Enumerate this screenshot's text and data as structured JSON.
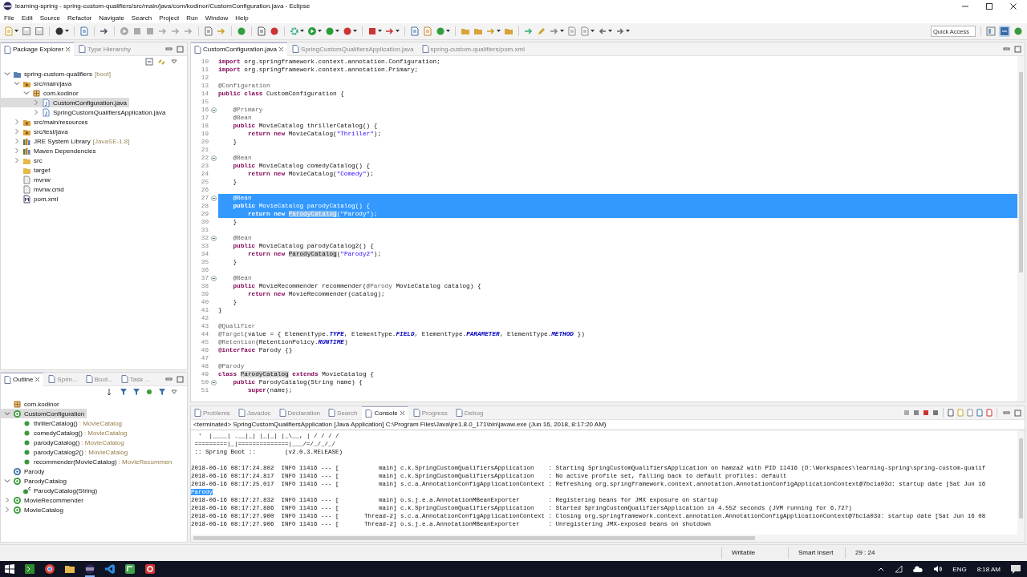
{
  "window": {
    "title": "learning-spring - spring-custom-qualifiers/src/main/java/com/kodinor/CustomConfiguration.java - Eclipse"
  },
  "menu": [
    "File",
    "Edit",
    "Source",
    "Refactor",
    "Navigate",
    "Search",
    "Project",
    "Run",
    "Window",
    "Help"
  ],
  "quick_access": {
    "placeholder": "Quick Access"
  },
  "package_explorer": {
    "tabs": [
      {
        "label": "Package Explorer",
        "selected": true
      },
      {
        "label": "Type Hierarchy",
        "selected": false
      }
    ],
    "tree": [
      {
        "label": "spring-custom-qualifiers",
        "suffix": "[boot]",
        "kind": "project",
        "expanded": true,
        "selected": false,
        "children": [
          {
            "label": "src/main/java",
            "kind": "source-folder",
            "expanded": true,
            "selected": false,
            "children": [
              {
                "label": "com.kodinor",
                "kind": "package",
                "expanded": true,
                "selected": false,
                "children": [
                  {
                    "label": "CustomConfiguration.java",
                    "kind": "java-file",
                    "expanded": false,
                    "selected": true
                  },
                  {
                    "label": "SpringCustomQualifiersApplication.java",
                    "kind": "java-file",
                    "expanded": false,
                    "selected": false
                  }
                ]
              }
            ]
          },
          {
            "label": "src/main/resources",
            "kind": "source-folder",
            "expanded": false,
            "selected": false
          },
          {
            "label": "src/test/java",
            "kind": "source-folder",
            "expanded": false,
            "selected": false
          },
          {
            "label": "JRE System Library",
            "suffix": "[JavaSE-1.8]",
            "kind": "library",
            "expanded": false,
            "selected": false
          },
          {
            "label": "Maven Dependencies",
            "kind": "library",
            "expanded": false,
            "selected": false
          },
          {
            "label": "src",
            "kind": "folder",
            "expanded": false,
            "selected": false
          },
          {
            "label": "target",
            "kind": "folder",
            "selected": false
          },
          {
            "label": "mvnw",
            "kind": "file",
            "selected": false
          },
          {
            "label": "mvnw.cmd",
            "kind": "file",
            "selected": false
          },
          {
            "label": "pom.xml",
            "kind": "xml",
            "selected": false
          }
        ]
      }
    ]
  },
  "outline": {
    "tabs": [
      {
        "label": "Outline",
        "selected": true
      },
      {
        "label": "Sprin...",
        "selected": false
      },
      {
        "label": "Boot...",
        "selected": false
      },
      {
        "label": "Task ...",
        "selected": false
      }
    ],
    "tree": [
      {
        "label": "com.kodinor",
        "kind": "package",
        "selected": false
      },
      {
        "label": "CustomConfiguration",
        "kind": "class",
        "expanded": true,
        "selected": true,
        "children": [
          {
            "label": "thrillerCatalog()",
            "type": ": MovieCatalog",
            "kind": "method",
            "selected": false
          },
          {
            "label": "comedyCatalog()",
            "type": ": MovieCatalog",
            "kind": "method",
            "selected": false
          },
          {
            "label": "parodyCatalog()",
            "type": ": MovieCatalog",
            "kind": "method",
            "selected": false
          },
          {
            "label": "parodyCatalog2()",
            "type": ": MovieCatalog",
            "kind": "method",
            "selected": false
          },
          {
            "label": "recommender(MovieCatalog)",
            "type": ": MovieRecommen",
            "kind": "method",
            "selected": false
          }
        ]
      },
      {
        "label": "Parody",
        "kind": "annotation",
        "selected": false
      },
      {
        "label": "ParodyCatalog",
        "kind": "class",
        "expanded": true,
        "selected": false,
        "children": [
          {
            "label": "ParodyCatalog(String)",
            "kind": "constructor",
            "selected": false
          }
        ]
      },
      {
        "label": "MovieRecommender",
        "kind": "class",
        "expanded": false,
        "selected": false
      },
      {
        "label": "MovieCatalog",
        "kind": "class",
        "expanded": false,
        "selected": false
      }
    ]
  },
  "editor": {
    "tabs": [
      {
        "label": "CustomConfiguration.java",
        "selected": true
      },
      {
        "label": "SpringCustomQualifiersApplication.java",
        "selected": false
      },
      {
        "label": "spring-custom-qualifiers/pom.xml",
        "selected": false
      }
    ],
    "lines": [
      {
        "num": "10",
        "fold": false,
        "selected": false,
        "segments": [
          {
            "kind": "keyword",
            "text": "import"
          },
          {
            "kind": "plain",
            "text": " org.springframework.context.annotation.Configuration;"
          }
        ]
      },
      {
        "num": "11",
        "fold": false,
        "selected": false,
        "segments": [
          {
            "kind": "keyword",
            "text": "import"
          },
          {
            "kind": "plain",
            "text": " org.springframework.context.annotation.Primary;"
          }
        ]
      },
      {
        "num": "12",
        "fold": false,
        "selected": false
      },
      {
        "num": "13",
        "fold": false,
        "selected": false,
        "segments": [
          {
            "kind": "annotation",
            "text": "@Configuration"
          }
        ]
      },
      {
        "num": "14",
        "fold": false,
        "selected": false,
        "segments": [
          {
            "kind": "keyword",
            "text": "public class"
          },
          {
            "kind": "plain",
            "text": " CustomConfiguration {"
          }
        ]
      },
      {
        "num": "15",
        "fold": false,
        "selected": false
      },
      {
        "num": "16",
        "fold": true,
        "selected": false,
        "segments": [
          {
            "kind": "annotation",
            "text": "    @Primary"
          }
        ]
      },
      {
        "num": "17",
        "fold": false,
        "selected": false,
        "segments": [
          {
            "kind": "annotation",
            "text": "    @Bean"
          }
        ]
      },
      {
        "num": "18",
        "fold": false,
        "selected": false,
        "segments": [
          {
            "kind": "keyword",
            "text": "    public"
          },
          {
            "kind": "plain",
            "text": " MovieCatalog thrillerCatalog() {"
          }
        ]
      },
      {
        "num": "19",
        "fold": false,
        "selected": false,
        "segments": [
          {
            "kind": "keyword",
            "text": "        return new"
          },
          {
            "kind": "plain",
            "text": " MovieCatalog("
          },
          {
            "kind": "string",
            "text": "\"Thriller\""
          },
          {
            "kind": "plain",
            "text": ");"
          }
        ]
      },
      {
        "num": "20",
        "fold": false,
        "selected": false,
        "segments": [
          {
            "kind": "plain",
            "text": "    }"
          }
        ]
      },
      {
        "num": "21",
        "fold": false,
        "selected": false
      },
      {
        "num": "22",
        "fold": true,
        "selected": false,
        "segments": [
          {
            "kind": "annotation",
            "text": "    @Bean"
          }
        ]
      },
      {
        "num": "23",
        "fold": false,
        "selected": false,
        "segments": [
          {
            "kind": "keyword",
            "text": "    public"
          },
          {
            "kind": "plain",
            "text": " MovieCatalog comedyCatalog() {"
          }
        ]
      },
      {
        "num": "24",
        "fold": false,
        "selected": false,
        "segments": [
          {
            "kind": "keyword",
            "text": "        return new"
          },
          {
            "kind": "plain",
            "text": " MovieCatalog("
          },
          {
            "kind": "string",
            "text": "\"Comedy\""
          },
          {
            "kind": "plain",
            "text": ");"
          }
        ]
      },
      {
        "num": "25",
        "fold": false,
        "selected": false,
        "segments": [
          {
            "kind": "plain",
            "text": "    }"
          }
        ]
      },
      {
        "num": "26",
        "fold": false,
        "selected": false
      },
      {
        "num": "27",
        "fold": true,
        "selected": true,
        "segments": [
          {
            "kind": "annotation",
            "text": "    @Bean"
          }
        ]
      },
      {
        "num": "28",
        "fold": false,
        "selected": true,
        "segments": [
          {
            "kind": "keyword",
            "text": "    public"
          },
          {
            "kind": "plain",
            "text": " MovieCatalog parodyCatalog() {"
          }
        ]
      },
      {
        "num": "29",
        "fold": false,
        "selected": true,
        "segments": [
          {
            "kind": "keyword",
            "text": "        return new "
          },
          {
            "kind": "occurrence",
            "text": "ParodyCatalog"
          },
          {
            "kind": "plain",
            "text": "("
          },
          {
            "kind": "string",
            "text": "\"Parody\""
          },
          {
            "kind": "plain",
            "text": ");"
          }
        ]
      },
      {
        "num": "30",
        "fold": false,
        "selected": false,
        "segments": [
          {
            "kind": "plain",
            "text": "    }"
          }
        ]
      },
      {
        "num": "31",
        "fold": false,
        "selected": false
      },
      {
        "num": "32",
        "fold": true,
        "selected": false,
        "segments": [
          {
            "kind": "annotation",
            "text": "    @Bean"
          }
        ]
      },
      {
        "num": "33",
        "fold": false,
        "selected": false,
        "segments": [
          {
            "kind": "keyword",
            "text": "    public"
          },
          {
            "kind": "plain",
            "text": " MovieCatalog parodyCatalog2() {"
          }
        ]
      },
      {
        "num": "34",
        "fold": false,
        "selected": false,
        "segments": [
          {
            "kind": "keyword",
            "text": "        return new "
          },
          {
            "kind": "occurrence",
            "text": "ParodyCatalog"
          },
          {
            "kind": "plain",
            "text": "("
          },
          {
            "kind": "string",
            "text": "\"Parody2\""
          },
          {
            "kind": "plain",
            "text": ");"
          }
        ]
      },
      {
        "num": "35",
        "fold": false,
        "selected": false,
        "segments": [
          {
            "kind": "plain",
            "text": "    }"
          }
        ]
      },
      {
        "num": "36",
        "fold": false,
        "selected": false
      },
      {
        "num": "37",
        "fold": true,
        "selected": false,
        "segments": [
          {
            "kind": "annotation",
            "text": "    @Bean"
          }
        ]
      },
      {
        "num": "38",
        "fold": false,
        "selected": false,
        "segments": [
          {
            "kind": "keyword",
            "text": "    public"
          },
          {
            "kind": "plain",
            "text": " MovieRecommender recommender("
          },
          {
            "kind": "annotation",
            "text": "@Parody"
          },
          {
            "kind": "plain",
            "text": " MovieCatalog catalog) {"
          }
        ]
      },
      {
        "num": "39",
        "fold": false,
        "selected": false,
        "segments": [
          {
            "kind": "keyword",
            "text": "        return new"
          },
          {
            "kind": "plain",
            "text": " MovieRecommender(catalog);"
          }
        ]
      },
      {
        "num": "40",
        "fold": false,
        "selected": false,
        "segments": [
          {
            "kind": "plain",
            "text": "    }"
          }
        ]
      },
      {
        "num": "41",
        "fold": false,
        "selected": false,
        "segments": [
          {
            "kind": "plain",
            "text": "}"
          }
        ]
      },
      {
        "num": "42",
        "fold": false,
        "selected": false
      },
      {
        "num": "43",
        "fold": false,
        "selected": false,
        "segments": [
          {
            "kind": "annotation",
            "text": "@Qualifier"
          }
        ]
      },
      {
        "num": "44",
        "fold": false,
        "selected": false,
        "segments": [
          {
            "kind": "annotation",
            "text": "@Target"
          },
          {
            "kind": "plain",
            "text": "(value = { ElementType."
          },
          {
            "kind": "field",
            "text": "TYPE"
          },
          {
            "kind": "plain",
            "text": ", ElementType."
          },
          {
            "kind": "field",
            "text": "FIELD"
          },
          {
            "kind": "plain",
            "text": ", ElementType."
          },
          {
            "kind": "field",
            "text": "PARAMETER"
          },
          {
            "kind": "plain",
            "text": ", ElementType."
          },
          {
            "kind": "field",
            "text": "METHOD"
          },
          {
            "kind": "plain",
            "text": " })"
          }
        ]
      },
      {
        "num": "45",
        "fold": false,
        "selected": false,
        "segments": [
          {
            "kind": "annotation",
            "text": "@Retention"
          },
          {
            "kind": "plain",
            "text": "(RetentionPolicy."
          },
          {
            "kind": "field",
            "text": "RUNTIME"
          },
          {
            "kind": "plain",
            "text": ")"
          }
        ]
      },
      {
        "num": "46",
        "fold": false,
        "selected": false,
        "segments": [
          {
            "kind": "keyword",
            "text": "@interface"
          },
          {
            "kind": "plain",
            "text": " Parody {}"
          }
        ]
      },
      {
        "num": "47",
        "fold": false,
        "selected": false
      },
      {
        "num": "48",
        "fold": false,
        "selected": false,
        "segments": [
          {
            "kind": "annotation",
            "text": "@Parody"
          }
        ]
      },
      {
        "num": "49",
        "fold": false,
        "selected": false,
        "segments": [
          {
            "kind": "keyword",
            "text": "class "
          },
          {
            "kind": "occurrence",
            "text": "ParodyCatalog"
          },
          {
            "kind": "keyword",
            "text": " extends"
          },
          {
            "kind": "plain",
            "text": " MovieCatalog {"
          }
        ]
      },
      {
        "num": "50",
        "fold": true,
        "selected": false,
        "segments": [
          {
            "kind": "keyword",
            "text": "    public"
          },
          {
            "kind": "plain",
            "text": " ParodyCatalog(String name) {"
          }
        ]
      },
      {
        "num": "51",
        "fold": false,
        "selected": false,
        "segments": [
          {
            "kind": "keyword",
            "text": "        super"
          },
          {
            "kind": "plain",
            "text": "(name);"
          }
        ]
      }
    ]
  },
  "console": {
    "tabs": [
      {
        "label": "Problems",
        "selected": false
      },
      {
        "label": "Javadoc",
        "selected": false
      },
      {
        "label": "Declaration",
        "selected": false
      },
      {
        "label": "Search",
        "selected": false
      },
      {
        "label": "Console",
        "selected": true
      },
      {
        "label": "Progress",
        "selected": false
      },
      {
        "label": "Debug",
        "selected": false
      }
    ],
    "header": "<terminated> SpringCustomQualifiersApplication [Java Application] C:\\Program Files\\Java\\jre1.8.0_171\\bin\\javaw.exe (Jun 16, 2018, 8:17:20 AM)",
    "lines": [
      {
        "text": "  '  |____| .__|_| |_|_| |_\\__, | / / / /",
        "selected": false
      },
      {
        "text": " =========|_|==============|___/=/_/_/_/",
        "selected": false
      },
      {
        "text": " :: Spring Boot ::        (v2.0.3.RELEASE)",
        "selected": false
      },
      {
        "selected": false
      },
      {
        "text": "2018-06-16 08:17:24.802  INFO 11416 --- [           main] c.k.SpringCustomQualifiersApplication    : Starting SpringCustomQualifiersApplication on hamza2 with PID 11416 (D:\\Workspaces\\learning-spring\\spring-custom-qualif",
        "selected": false
      },
      {
        "text": "2018-06-16 08:17:24.817  INFO 11416 --- [           main] c.k.SpringCustomQualifiersApplication    : No active profile set, falling back to default profiles: default",
        "selected": false
      },
      {
        "text": "2018-06-16 08:17:25.017  INFO 11416 --- [           main] s.c.a.AnnotationConfigApplicationContext : Refreshing org.springframework.context.annotation.AnnotationConfigApplicationContext@7bc1a03d: startup date [Sat Jun 16",
        "selected": false
      },
      {
        "text": "Parody",
        "selected": true
      },
      {
        "text": "2018-06-16 08:17:27.832  INFO 11416 --- [           main] o.s.j.e.a.AnnotationMBeanExporter        : Registering beans for JMX exposure on startup",
        "selected": false
      },
      {
        "text": "2018-06-16 08:17:27.886  INFO 11416 --- [           main] c.k.SpringCustomQualifiersApplication    : Started SpringCustomQualifiersApplication in 4.552 seconds (JVM running for 6.727)",
        "selected": false
      },
      {
        "text": "2018-06-16 08:17:27.900  INFO 11416 --- [       Thread-2] s.c.a.AnnotationConfigApplicationContext : Closing org.springframework.context.annotation.AnnotationConfigApplicationContext@7bc1a03d: startup date [Sat Jun 16 08",
        "selected": false
      },
      {
        "text": "2018-06-16 08:17:27.906  INFO 11416 --- [       Thread-2] o.s.j.e.a.AnnotationMBeanExporter        : Unregistering JMX-exposed beans on shutdown",
        "selected": false
      }
    ]
  },
  "status_bar": {
    "mode": "Writable",
    "insert": "Smart Insert",
    "position": "29 : 24"
  },
  "taskbar": {
    "language": "ENG",
    "time": "8:18 AM"
  }
}
